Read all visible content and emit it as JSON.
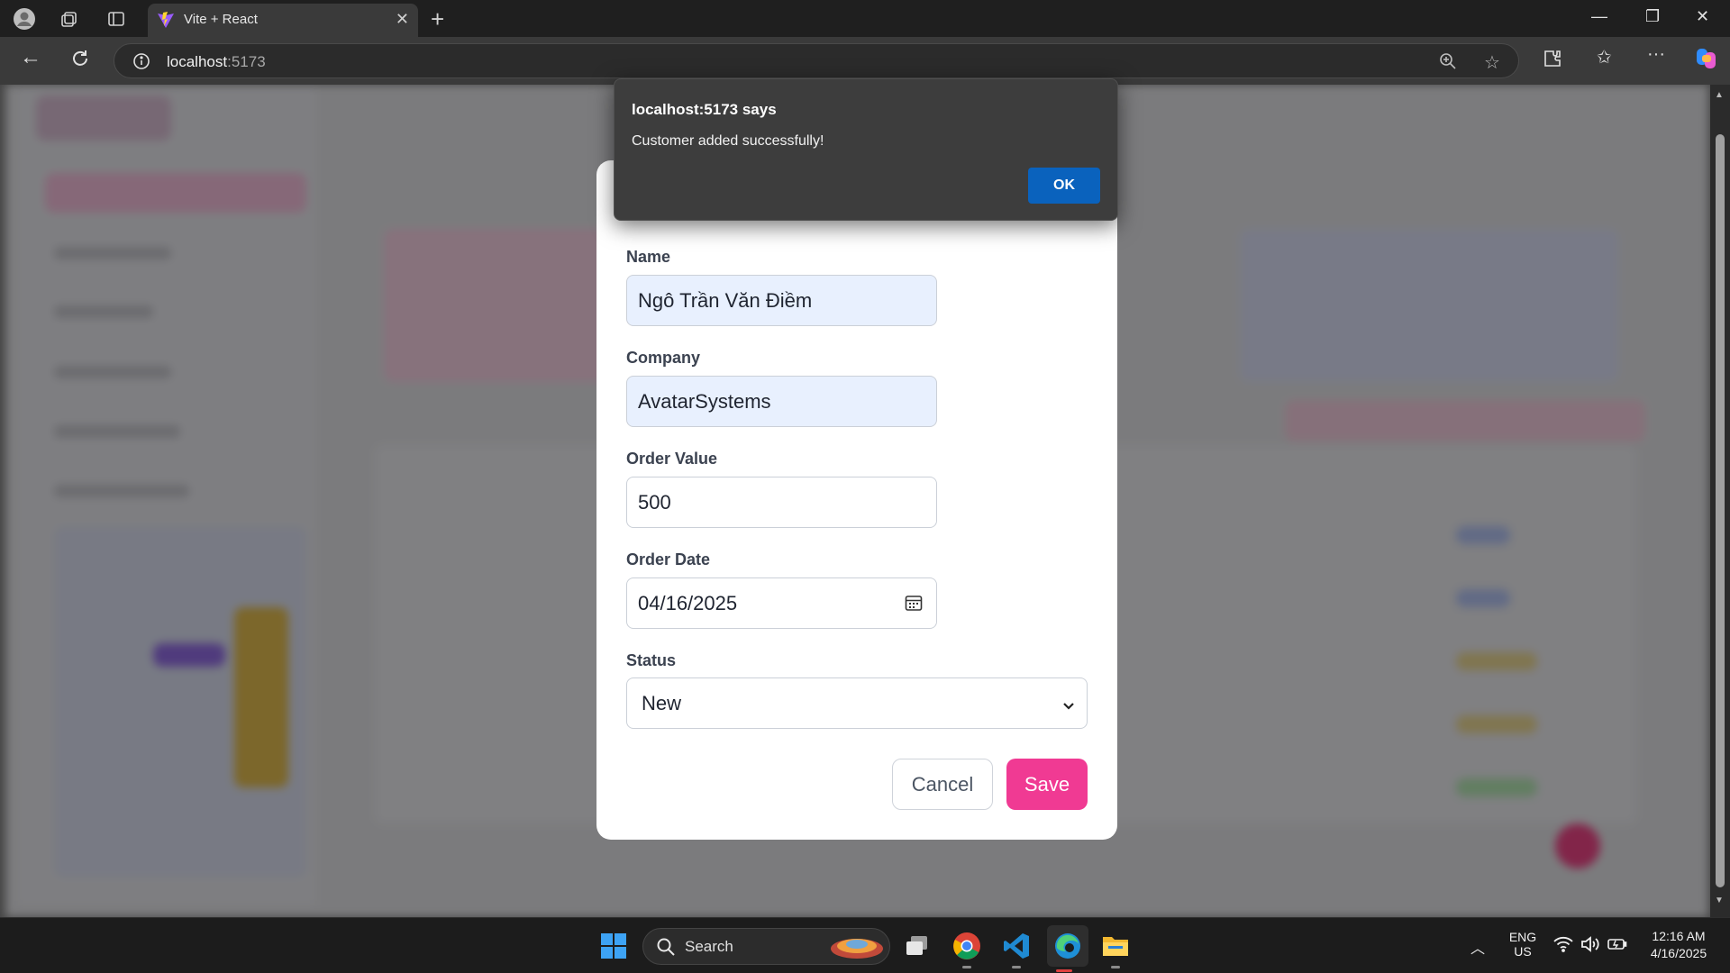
{
  "browser": {
    "tab_title": "Vite + React",
    "url_host": "localhost",
    "url_port": ":5173"
  },
  "dialog": {
    "title": "localhost:5173 says",
    "message": "Customer added successfully!",
    "ok_label": "OK"
  },
  "form": {
    "name_label": "Name",
    "name_value": "Ngô Trần Văn Điềm",
    "company_label": "Company",
    "company_value": "AvatarSystems",
    "order_value_label": "Order Value",
    "order_value": "500",
    "order_date_label": "Order Date",
    "order_date_value": "04/16/2025",
    "status_label": "Status",
    "status_value": "New",
    "cancel_label": "Cancel",
    "save_label": "Save"
  },
  "taskbar": {
    "search_label": "Search",
    "lang_primary": "ENG",
    "lang_secondary": "US",
    "time": "12:16 AM",
    "date": "4/16/2025"
  },
  "colors": {
    "accent_pink": "#f03a93",
    "dialog_ok_blue": "#0a62bd",
    "autofill_bg": "#e8f0fe"
  }
}
